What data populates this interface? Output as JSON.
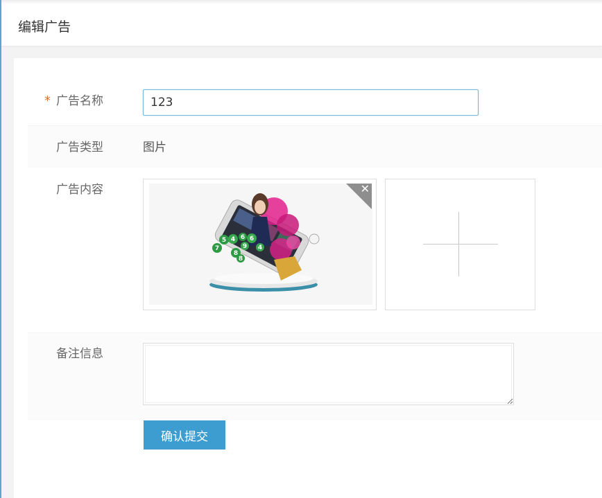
{
  "page_title": "编辑广告",
  "form": {
    "name": {
      "required_mark": "*",
      "label": "广告名称",
      "value": "123"
    },
    "type": {
      "label": "广告类型",
      "value": "图片"
    },
    "content": {
      "label": "广告内容",
      "remove_symbol": "✕"
    },
    "remark": {
      "label": "备注信息",
      "value": ""
    },
    "submit_label": "确认提交"
  },
  "colors": {
    "accent": "#3e9dd0",
    "required": "#e0712c",
    "focus_border": "#6fb8d9"
  },
  "icons": [
    "close-icon",
    "add-image-plus-icon"
  ]
}
